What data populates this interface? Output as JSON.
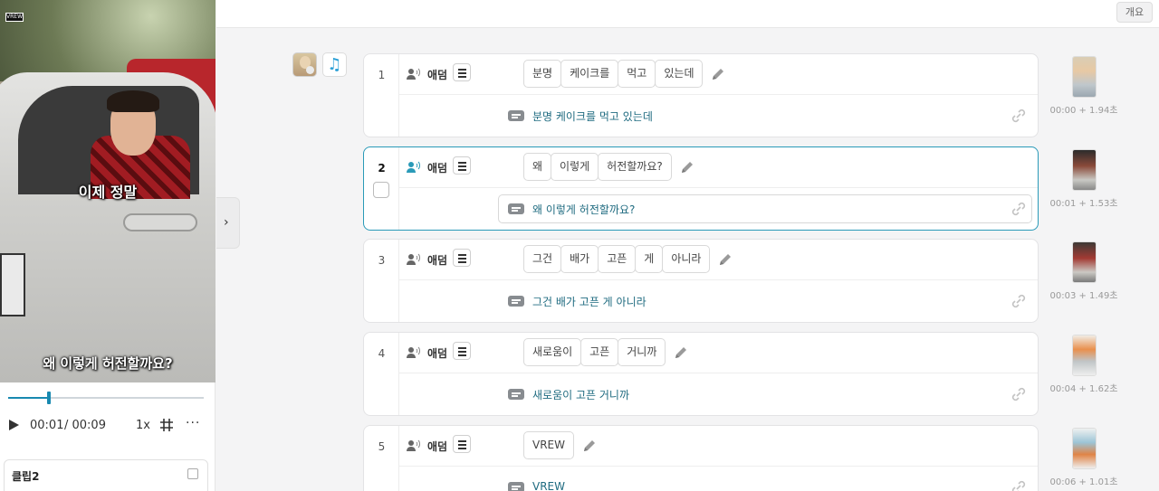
{
  "player": {
    "watermark": "VREW",
    "caption_top": "이제 정말",
    "caption_bottom": "왜 이렇게 허전할까요?",
    "progress": 0.21,
    "time_current": "00:01",
    "time_total": "/ 00:09",
    "speed": "1x",
    "more": "···"
  },
  "clip_card": {
    "title": "클립2"
  },
  "topbar": {
    "overview_button": "개요"
  },
  "rows": [
    {
      "num": "1",
      "speaker": "애덤",
      "words": [
        "분명",
        "케이크를",
        "먹고",
        "있는데"
      ],
      "subtitle": "분명 케이크를 먹고 있는데",
      "time": "00:00 + 1.94초",
      "active": false
    },
    {
      "num": "2",
      "speaker": "애덤",
      "words": [
        "왜",
        "이렇게",
        "허전할까요?"
      ],
      "subtitle": "왜 이렇게 허전할까요?",
      "time": "00:01 + 1.53초",
      "active": true
    },
    {
      "num": "3",
      "speaker": "애덤",
      "words": [
        "그건",
        "배가",
        "고픈",
        "게",
        "아니라"
      ],
      "subtitle": "그건 배가 고픈 게 아니라",
      "time": "00:03 + 1.49초",
      "active": false
    },
    {
      "num": "4",
      "speaker": "애덤",
      "words": [
        "새로움이",
        "고픈",
        "거니까"
      ],
      "subtitle": "새로움이 고픈 거니까",
      "time": "00:04 + 1.62초",
      "active": false
    },
    {
      "num": "5",
      "speaker": "애덤",
      "words": [
        "VREW"
      ],
      "subtitle": "VREW",
      "time": "00:06 + 1.01초",
      "active": false
    }
  ],
  "colors": {
    "accent": "#1889b0",
    "subtitle_text": "#1f6b80",
    "active_border": "#2a9ab8"
  }
}
